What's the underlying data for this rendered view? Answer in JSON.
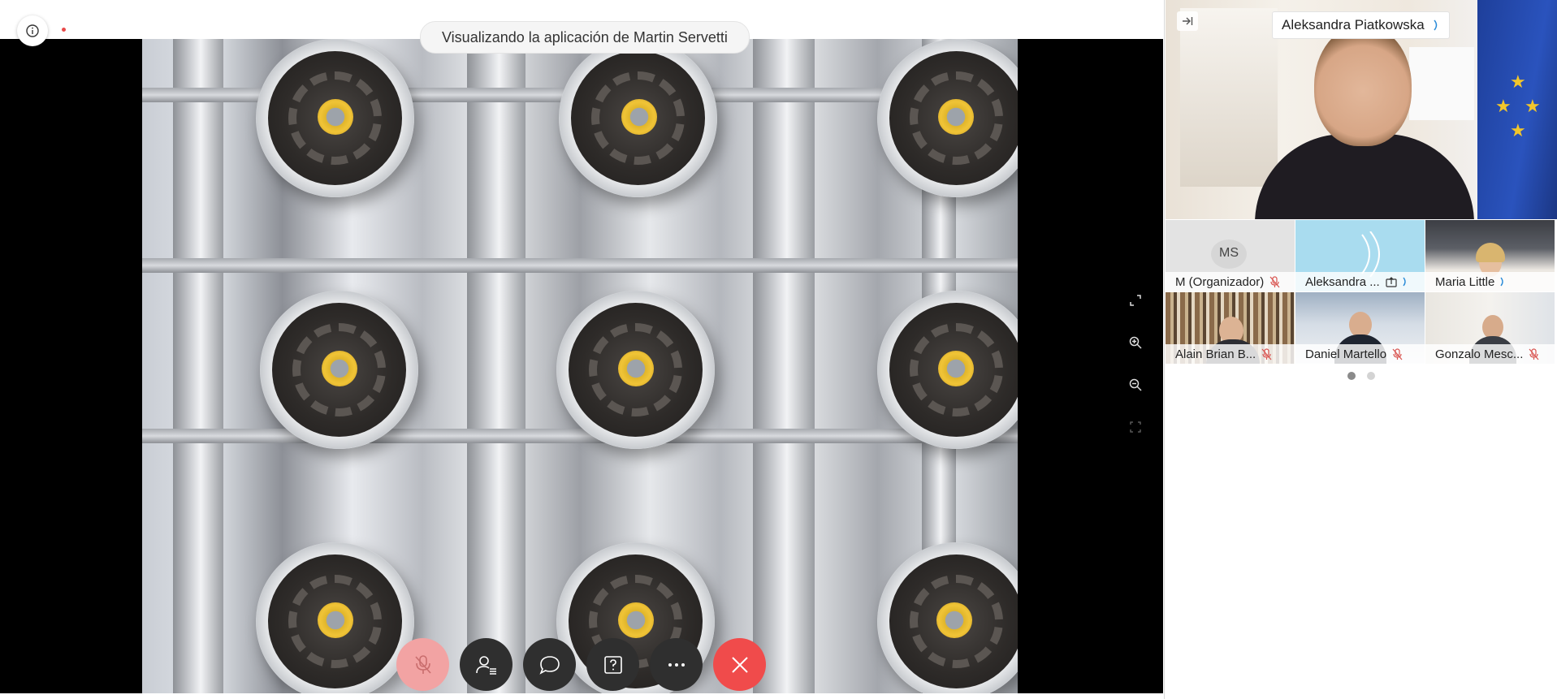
{
  "stage": {
    "viewing_text": "Visualizando la aplicación de",
    "viewing_name": "Martin Servetti",
    "info_icon": "info-icon",
    "recording_indicator": "recording-dot-icon",
    "side_tools": [
      "fullscreen-icon",
      "zoom-in-icon",
      "zoom-out-icon",
      "fit-screen-icon"
    ],
    "controls": [
      {
        "name": "mute-button",
        "icon": "microphone-muted-icon"
      },
      {
        "name": "participants-button",
        "icon": "participants-icon"
      },
      {
        "name": "chat-button",
        "icon": "chat-icon"
      },
      {
        "name": "qa-button",
        "icon": "question-icon"
      },
      {
        "name": "more-button",
        "icon": "more-icon"
      },
      {
        "name": "leave-button",
        "icon": "close-icon"
      }
    ]
  },
  "panel": {
    "active_speaker": "Aleksandra Piatkowska",
    "participants": [
      {
        "initials": "MS",
        "name": "M (Organizador)",
        "status": "muted"
      },
      {
        "name": "Aleksandra ...",
        "status": "sharing"
      },
      {
        "name": "Maria Little",
        "status": "speaking"
      },
      {
        "name": "Alain Brian B...",
        "status": "muted"
      },
      {
        "name": "Daniel Martello",
        "status": "muted"
      },
      {
        "name": "Gonzalo Mesc...",
        "status": "muted"
      }
    ],
    "pages": 2,
    "current_page": 1
  },
  "colors": {
    "leave": "#f04b4b",
    "control_bg": "#2f2f2f",
    "muted_icon": "#d9534f",
    "speaking_icon": "#2a8bd8",
    "sharing_tile": "#a9dcef"
  }
}
